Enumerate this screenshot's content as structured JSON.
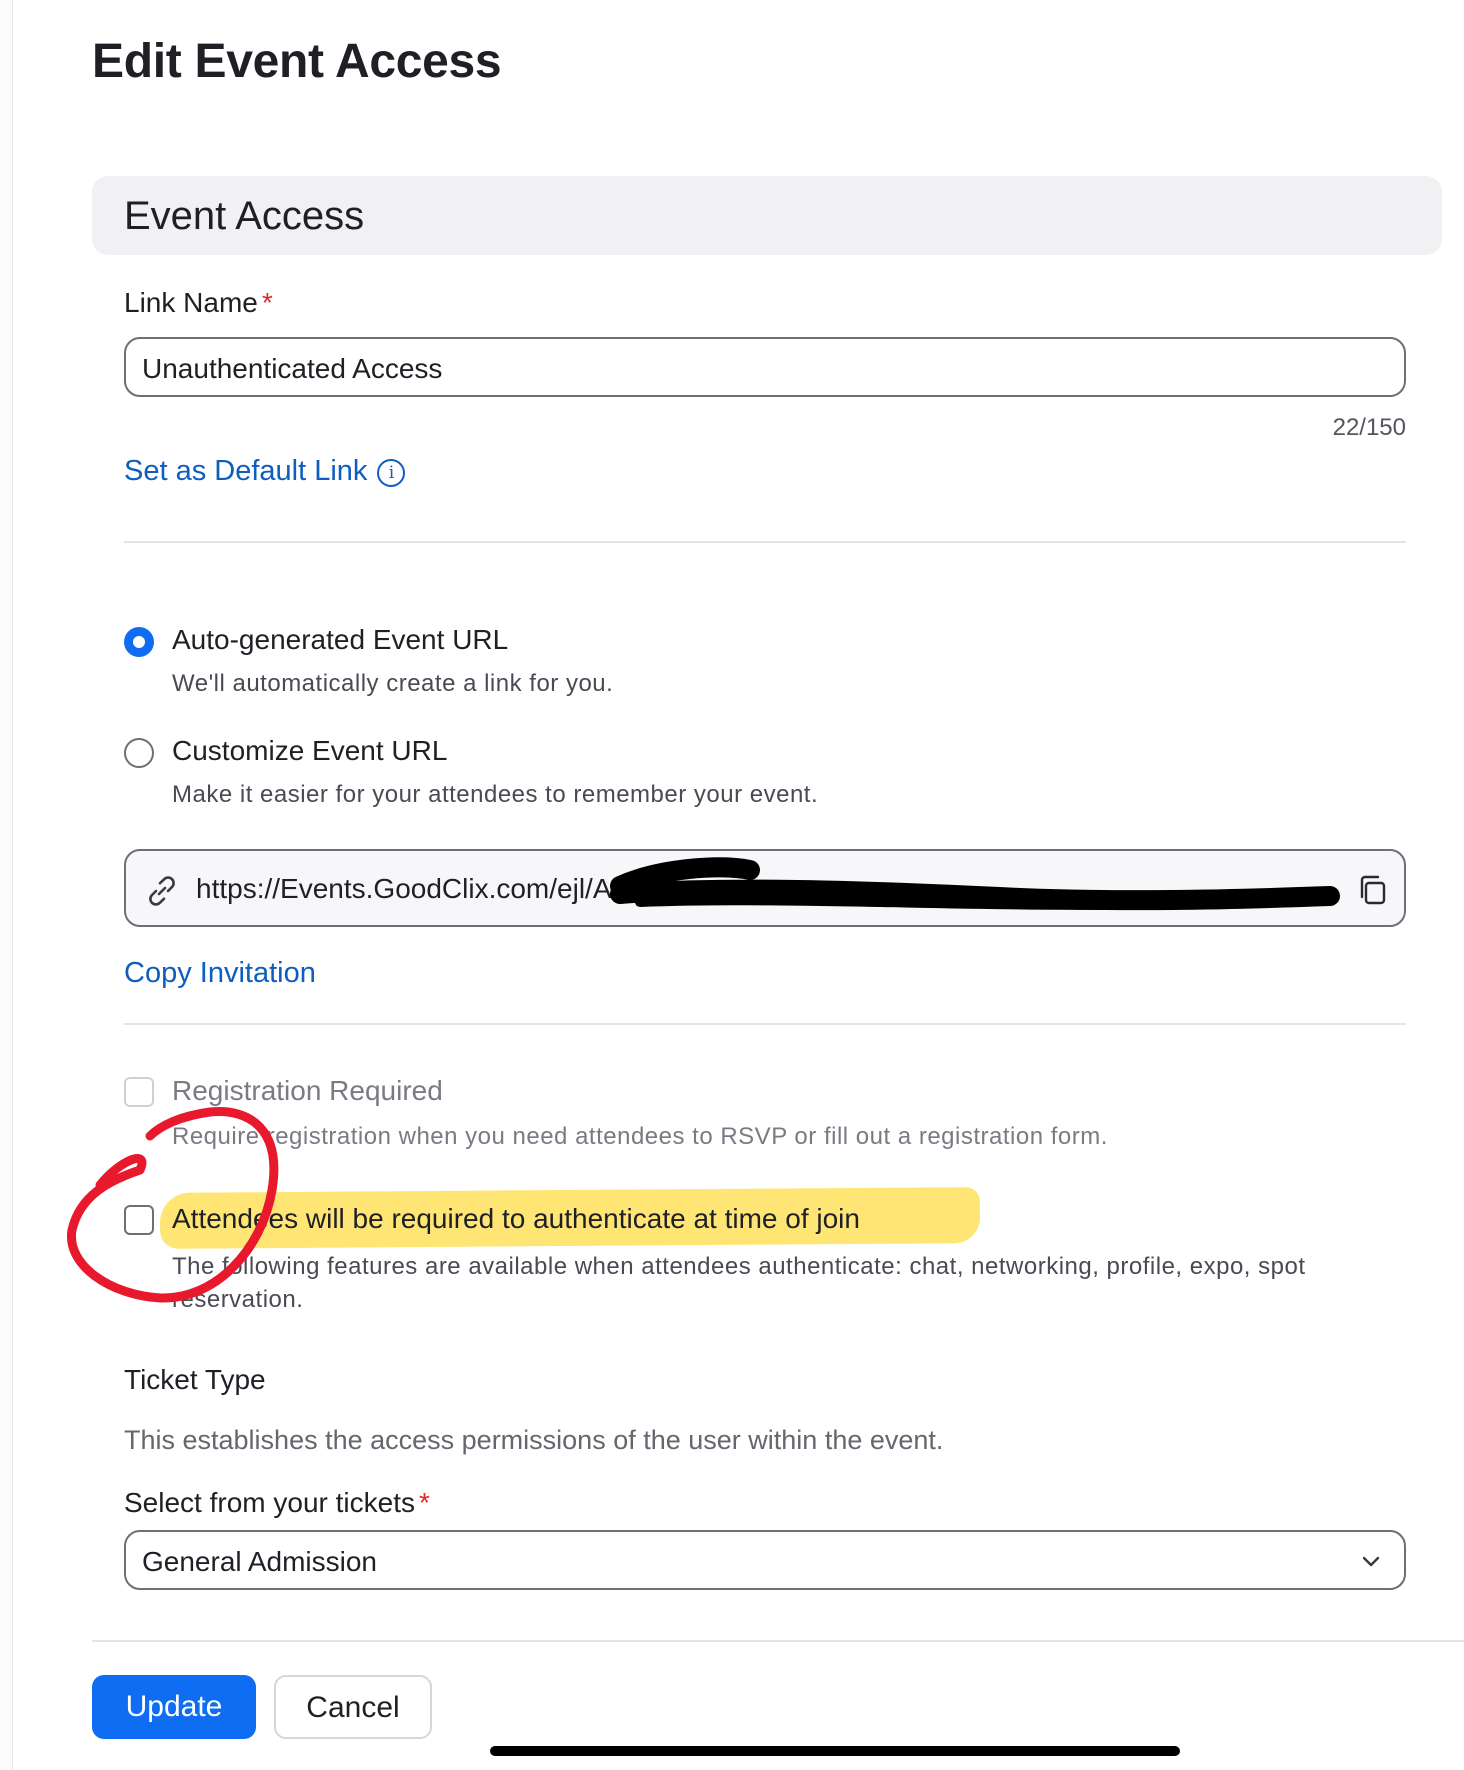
{
  "page": {
    "title": "Edit Event Access"
  },
  "section": {
    "title": "Event Access"
  },
  "link_name": {
    "label": "Link Name",
    "required_mark": "*",
    "value": "Unauthenticated Access",
    "counter": "22/150"
  },
  "default_link": {
    "label": "Set as Default Link",
    "icon": "info-icon"
  },
  "url_options": [
    {
      "title": "Auto-generated Event URL",
      "description": "We'll automatically create a link for you.",
      "selected": true
    },
    {
      "title": "Customize Event URL",
      "description": "Make it easier for your attendees to remember your event.",
      "selected": false
    }
  ],
  "event_url": {
    "value": "https://Events.GoodClix.com/ejl/A",
    "icon": "link-icon",
    "copy_icon": "copy-icon"
  },
  "copy_invitation": "Copy Invitation",
  "checkboxes": [
    {
      "title": "Registration Required",
      "description": "Require registration when you need attendees to RSVP or fill out a registration form.",
      "checked": false,
      "disabled": true
    },
    {
      "title": "Attendees will be required to authenticate at time of join",
      "description": "The following features are available when attendees authenticate: chat, networking, profile, expo, spot reservation.",
      "checked": false,
      "disabled": false
    }
  ],
  "ticket": {
    "heading": "Ticket Type",
    "description": "This establishes the access permissions of the user within the event.",
    "select_label": "Select from your tickets",
    "required_mark": "*",
    "selected": "General Admission"
  },
  "buttons": {
    "update": "Update",
    "cancel": "Cancel"
  },
  "colors": {
    "accent": "#0e6df2",
    "link": "#0e5ebf",
    "required": "#e02828",
    "highlight": "#ffe25c",
    "annotation": "#e8192c"
  }
}
